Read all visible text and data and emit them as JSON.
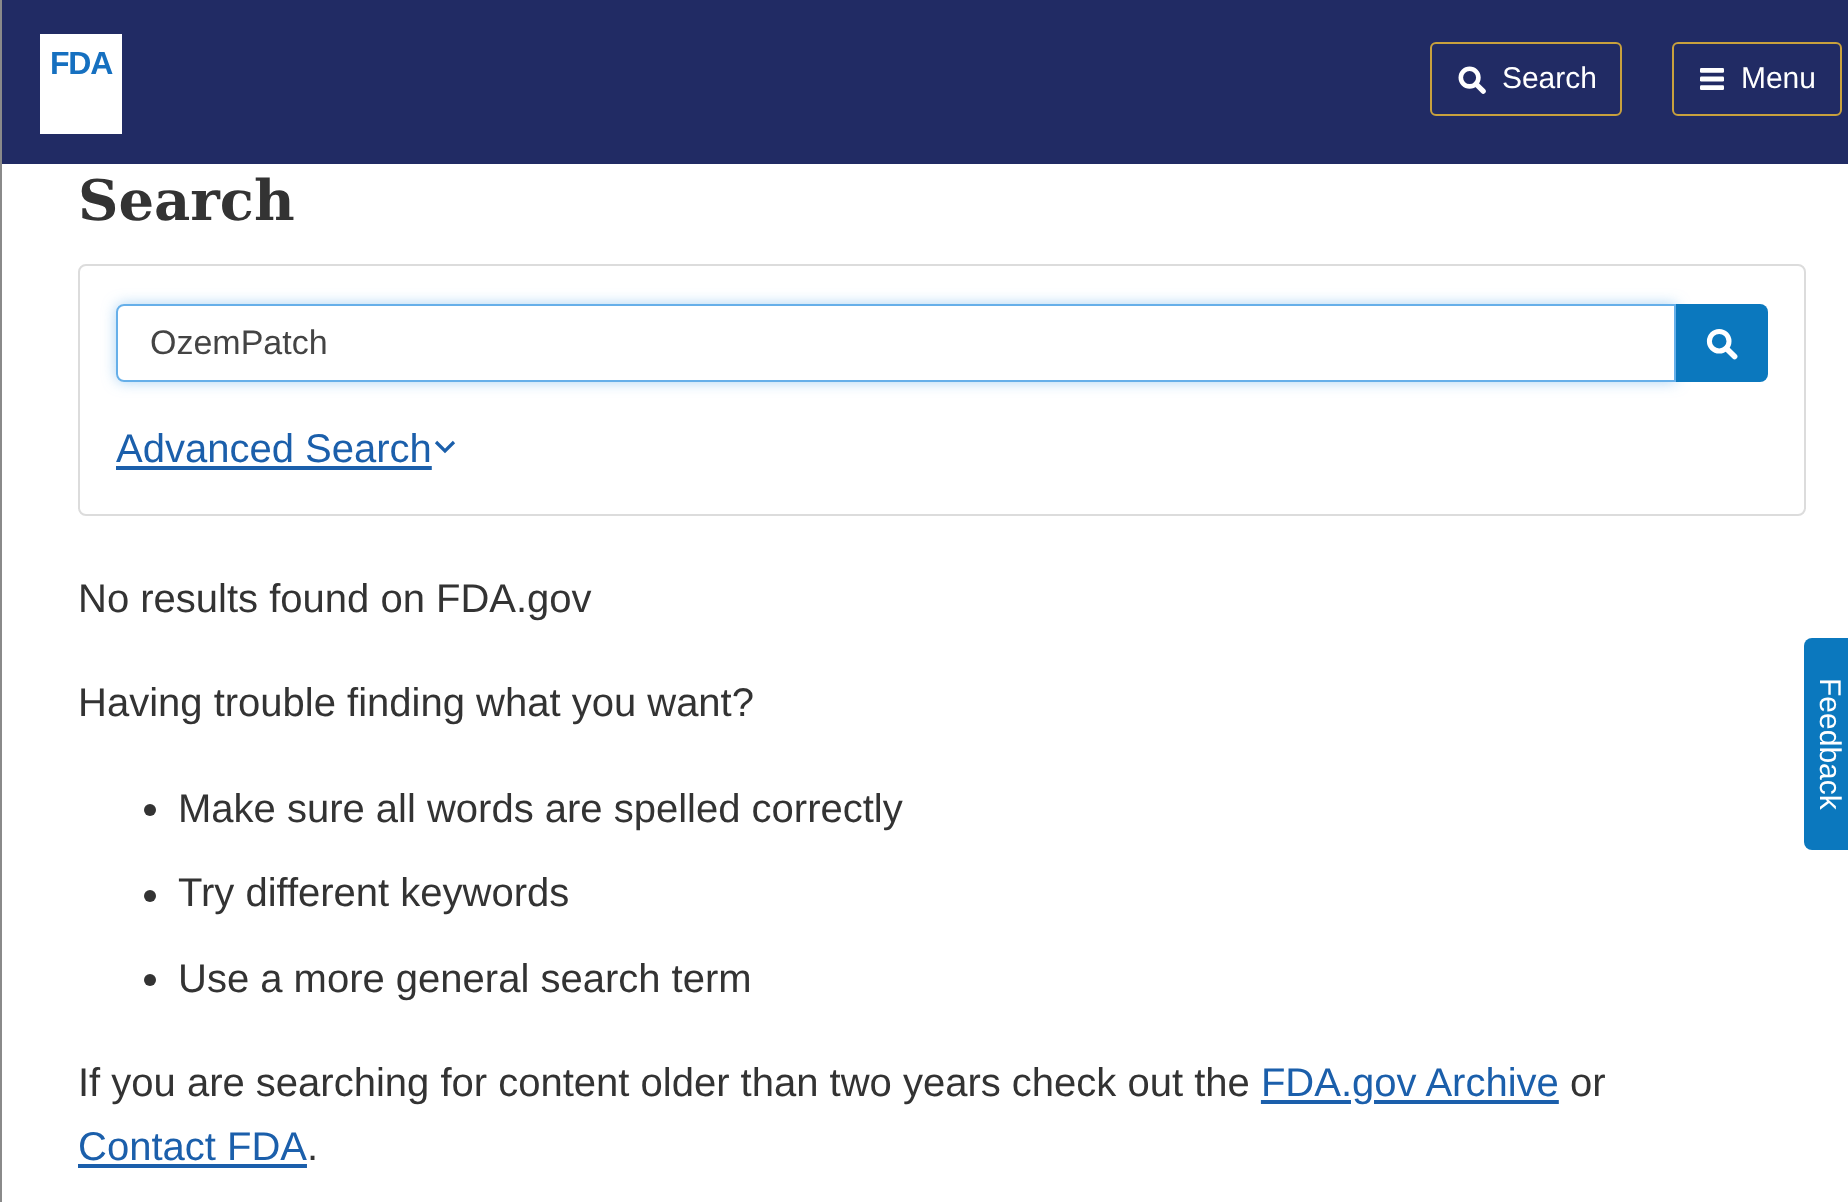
{
  "header": {
    "logo": {
      "text": "FDA"
    },
    "buttons": [
      {
        "kind": "search",
        "label": "Search"
      },
      {
        "kind": "menu",
        "label": "Menu"
      }
    ]
  },
  "page_title": "Search",
  "search_form": {
    "query": "OzemPatch",
    "focused": true,
    "advanced_link": "Advanced Search"
  },
  "results": {
    "message": "No results found on FDA.gov",
    "help_heading": "Having trouble finding what you want?",
    "tips": [
      "Make sure all words are spelled correctly",
      "Try different keywords",
      "Use a more general search term"
    ],
    "footer_note": [
      {
        "kind": "text",
        "text": "If you are searching for content older than two years check out the "
      },
      {
        "kind": "link",
        "text": "FDA.gov Archive"
      },
      {
        "kind": "text",
        "text": " or "
      },
      {
        "kind": "link",
        "text": "Contact FDA"
      },
      {
        "kind": "text",
        "text": "."
      }
    ]
  },
  "feedback_tab": {
    "label": "Feedback"
  }
}
